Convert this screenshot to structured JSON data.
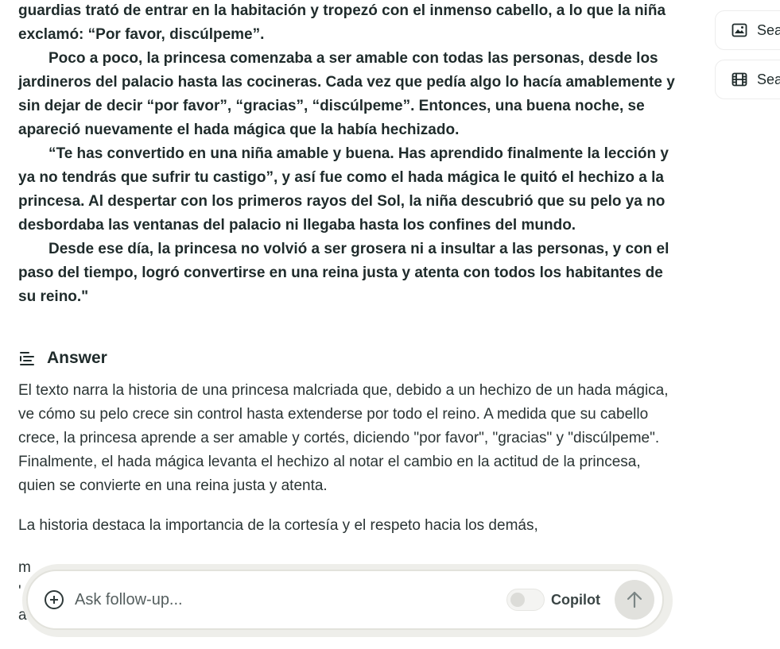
{
  "question": {
    "paragraphs": [
      {
        "text": "guardias trató de entrar en la habitación y tropezó con el inmenso cabello, a lo que la niña exclamó: “Por favor, discúlpeme”.",
        "indent": false
      },
      {
        "text": "Poco a poco, la princesa comenzaba a ser amable con todas las personas, desde los jardineros del palacio hasta las cocineras. Cada vez que pedía algo lo hacía amablemente y sin dejar de decir “por favor”, “gracias”, “discúlpeme”. Entonces, una buena noche, se apareció nuevamente el hada mágica que la había hechizado.",
        "indent": true
      },
      {
        "text": "“Te has convertido en una niña amable y buena. Has aprendido finalmente la lección y ya no tendrás que sufrir tu castigo”, y así fue como el hada mágica le quitó el hechizo a la princesa. Al despertar con los primeros rayos del Sol, la niña descubrió que su pelo ya no desbordaba las ventanas del palacio ni llegaba hasta los confines del mundo.",
        "indent": true
      },
      {
        "text": "Desde ese día, la princesa no volvió a ser grosera ni a insultar a las personas, y con el paso del tiempo, logró convertirse en una reina justa y atenta con todos los habitantes de su reino.\"",
        "indent": true
      }
    ]
  },
  "answer": {
    "heading": "Answer",
    "icon": "answer-lines-icon",
    "paragraphs": [
      "El texto narra la historia de una princesa malcriada que, debido a un hechizo de un hada mágica, ve cómo su pelo crece sin control hasta extenderse por todo el reino. A medida que su cabello crece, la princesa aprende a ser amable y cortés, diciendo \"por favor\", \"gracias\" y \"discúlpeme\". Finalmente, el hada mágica levanta el hechizo al notar el cambio en la actitud de la princesa, quien se convierte en una reina justa y atenta.",
      "La historia destaca la importancia de la cortesía y el respeto hacia los demás,"
    ],
    "partial_lines": [
      "m",
      "'",
      "a"
    ]
  },
  "sidebar": {
    "items": [
      {
        "label": "Sea",
        "icon": "image-icon"
      },
      {
        "label": "Sea",
        "icon": "video-icon"
      }
    ]
  },
  "composer": {
    "placeholder": "Ask follow-up...",
    "copilot_label": "Copilot",
    "copilot_enabled": false
  }
}
